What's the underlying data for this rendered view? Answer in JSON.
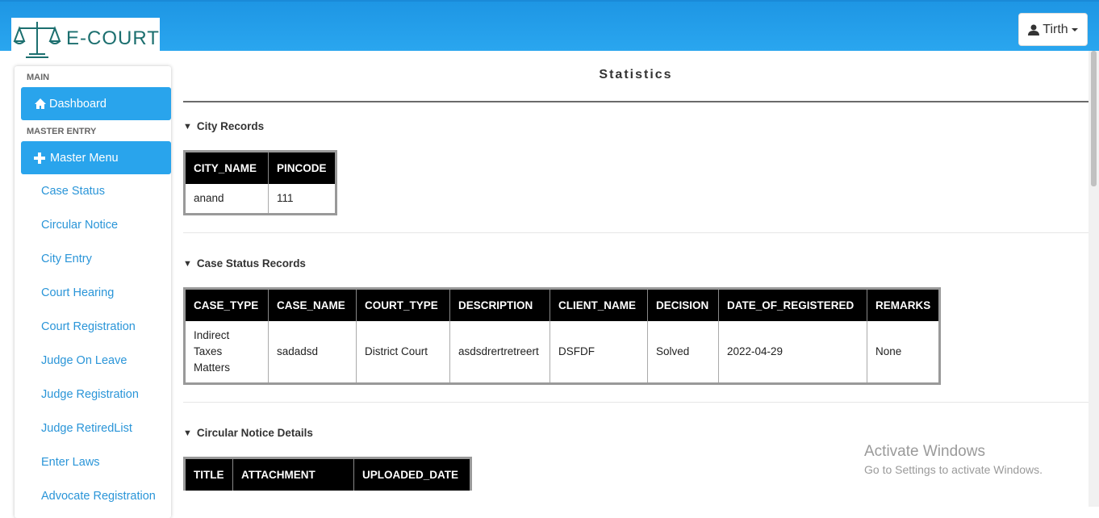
{
  "header": {
    "logo_text": "E-COURT",
    "user_name": "Tirth",
    "brand_color": "#2aa6ef"
  },
  "sidebar": {
    "section_main": "MAIN",
    "dashboard": "Dashboard",
    "section_master": "MASTER ENTRY",
    "master_menu": "Master Menu",
    "items": [
      {
        "label": "Case Status"
      },
      {
        "label": "Circular Notice"
      },
      {
        "label": "City Entry"
      },
      {
        "label": "Court Hearing"
      },
      {
        "label": "Court Registration"
      },
      {
        "label": "Judge On Leave"
      },
      {
        "label": "Judge Registration"
      },
      {
        "label": "Judge RetiredList"
      },
      {
        "label": "Enter Laws"
      },
      {
        "label": "Advocate Registration"
      }
    ],
    "icons": {
      "dashboard": "home-icon",
      "master": "plus-icon"
    }
  },
  "main": {
    "title": "Statistics",
    "city": {
      "heading": "City Records",
      "headers": [
        "CITY_NAME",
        "PINCODE"
      ],
      "rows": [
        [
          "anand",
          "111"
        ]
      ]
    },
    "case_status": {
      "heading": "Case Status Records",
      "headers": [
        "CASE_TYPE",
        "CASE_NAME",
        "COURT_TYPE",
        "DESCRIPTION",
        "CLIENT_NAME",
        "DECISION",
        "DATE_OF_REGISTERED",
        "REMARKS"
      ],
      "rows": [
        [
          "Indirect Taxes Matters",
          "sadadsd",
          "District Court",
          "asdsdrertretreert",
          "DSFDF",
          "Solved",
          "2022-04-29",
          "None"
        ]
      ]
    },
    "circular": {
      "heading": "Circular Notice Details",
      "headers": [
        "TITLE",
        "ATTACHMENT",
        "UPLOADED_DATE"
      ]
    }
  },
  "watermark": {
    "line1": "Activate Windows",
    "line2": "Go to Settings to activate Windows."
  }
}
